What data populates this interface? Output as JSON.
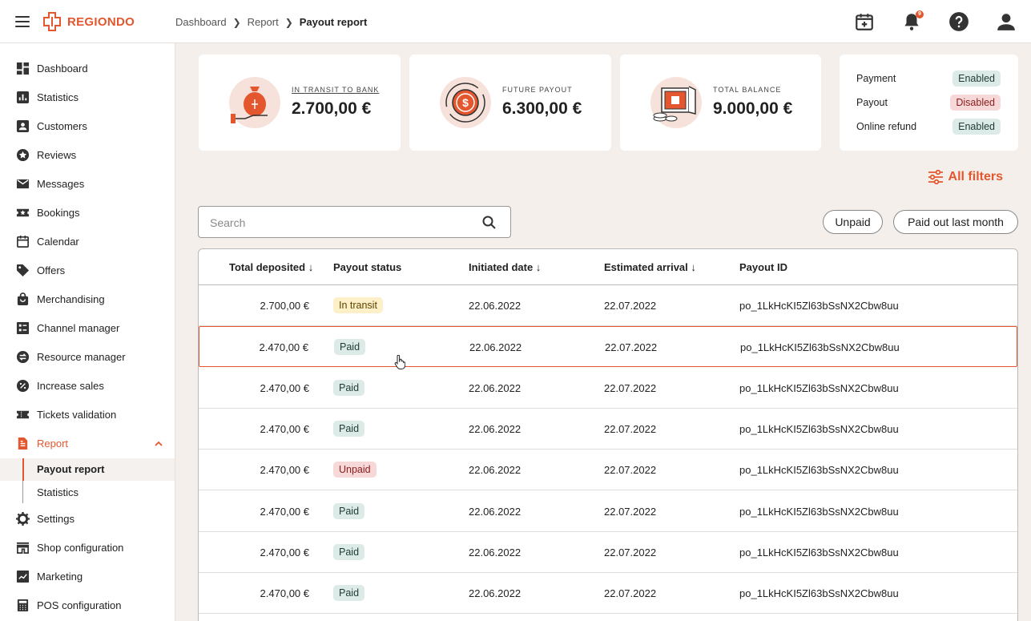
{
  "brand": {
    "name": "REGIONDO",
    "accent": "#e4572e"
  },
  "breadcrumb": [
    "Dashboard",
    "Report",
    "Payout report"
  ],
  "header_icons": [
    "calendar-add-icon",
    "bell-icon",
    "help-icon",
    "user-icon"
  ],
  "notification_count": "9",
  "sidebar": {
    "items": [
      {
        "label": "Dashboard",
        "icon": "dashboard-icon"
      },
      {
        "label": "Statistics",
        "icon": "statistics-icon"
      },
      {
        "label": "Customers",
        "icon": "customers-icon"
      },
      {
        "label": "Reviews",
        "icon": "star-icon"
      },
      {
        "label": "Messages",
        "icon": "mail-icon"
      },
      {
        "label": "Bookings",
        "icon": "ticket-star-icon"
      },
      {
        "label": "Calendar",
        "icon": "calendar-icon"
      },
      {
        "label": "Offers",
        "icon": "tag-icon"
      },
      {
        "label": "Merchandising",
        "icon": "shopping-bag-icon"
      },
      {
        "label": "Channel manager",
        "icon": "channel-icon"
      },
      {
        "label": "Resource manager",
        "icon": "resource-icon"
      },
      {
        "label": "Increase sales",
        "icon": "percent-icon"
      },
      {
        "label": "Tickets validation",
        "icon": "ticket-icon"
      },
      {
        "label": "Report",
        "icon": "report-icon"
      },
      {
        "label": "Settings",
        "icon": "gear-icon"
      },
      {
        "label": "Shop configuration",
        "icon": "store-icon"
      },
      {
        "label": "Marketing",
        "icon": "marketing-icon"
      },
      {
        "label": "POS configuration",
        "icon": "calculator-icon"
      }
    ],
    "report_sub": [
      "Payout report",
      "Statistics"
    ]
  },
  "cards": [
    {
      "label": "IN TRANSIT TO BANK",
      "value": "2.700,00 €"
    },
    {
      "label": "FUTURE PAYOUT",
      "value": "6.300,00 €"
    },
    {
      "label": "TOTAL BALANCE",
      "value": "9.000,00 €"
    }
  ],
  "settings_status": [
    {
      "label": "Payment",
      "value": "Enabled"
    },
    {
      "label": "Payout",
      "value": "Disabled"
    },
    {
      "label": "Online refund",
      "value": "Enabled"
    }
  ],
  "filters": {
    "all_filters": "All filters",
    "search_placeholder": "Search",
    "chips": [
      "Unpaid",
      "Paid out last month"
    ]
  },
  "table": {
    "columns": [
      "Total deposited ↓",
      "Payout status",
      "Initiated date ↓",
      "Estimated arrival ↓",
      "Payout ID"
    ],
    "rows": [
      {
        "amount": "2.700,00 €",
        "status": "In transit",
        "initiated": "22.06.2022",
        "arrival": "22.07.2022",
        "id": "po_1LkHcKI5Zl63bSsNX2Cbw8uu"
      },
      {
        "amount": "2.470,00 €",
        "status": "Paid",
        "initiated": "22.06.2022",
        "arrival": "22.07.2022",
        "id": "po_1LkHcKI5Zl63bSsNX2Cbw8uu"
      },
      {
        "amount": "2.470,00 €",
        "status": "Paid",
        "initiated": "22.06.2022",
        "arrival": "22.07.2022",
        "id": "po_1LkHcKI5Zl63bSsNX2Cbw8uu"
      },
      {
        "amount": "2.470,00 €",
        "status": "Paid",
        "initiated": "22.06.2022",
        "arrival": "22.07.2022",
        "id": "po_1LkHcKI5Zl63bSsNX2Cbw8uu"
      },
      {
        "amount": "2.470,00 €",
        "status": "Unpaid",
        "initiated": "22.06.2022",
        "arrival": "22.07.2022",
        "id": "po_1LkHcKI5Zl63bSsNX2Cbw8uu"
      },
      {
        "amount": "2.470,00 €",
        "status": "Paid",
        "initiated": "22.06.2022",
        "arrival": "22.07.2022",
        "id": "po_1LkHcKI5Zl63bSsNX2Cbw8uu"
      },
      {
        "amount": "2.470,00 €",
        "status": "Paid",
        "initiated": "22.06.2022",
        "arrival": "22.07.2022",
        "id": "po_1LkHcKI5Zl63bSsNX2Cbw8uu"
      },
      {
        "amount": "2.470,00 €",
        "status": "Paid",
        "initiated": "22.06.2022",
        "arrival": "22.07.2022",
        "id": "po_1LkHcKI5Zl63bSsNX2Cbw8uu"
      }
    ]
  }
}
